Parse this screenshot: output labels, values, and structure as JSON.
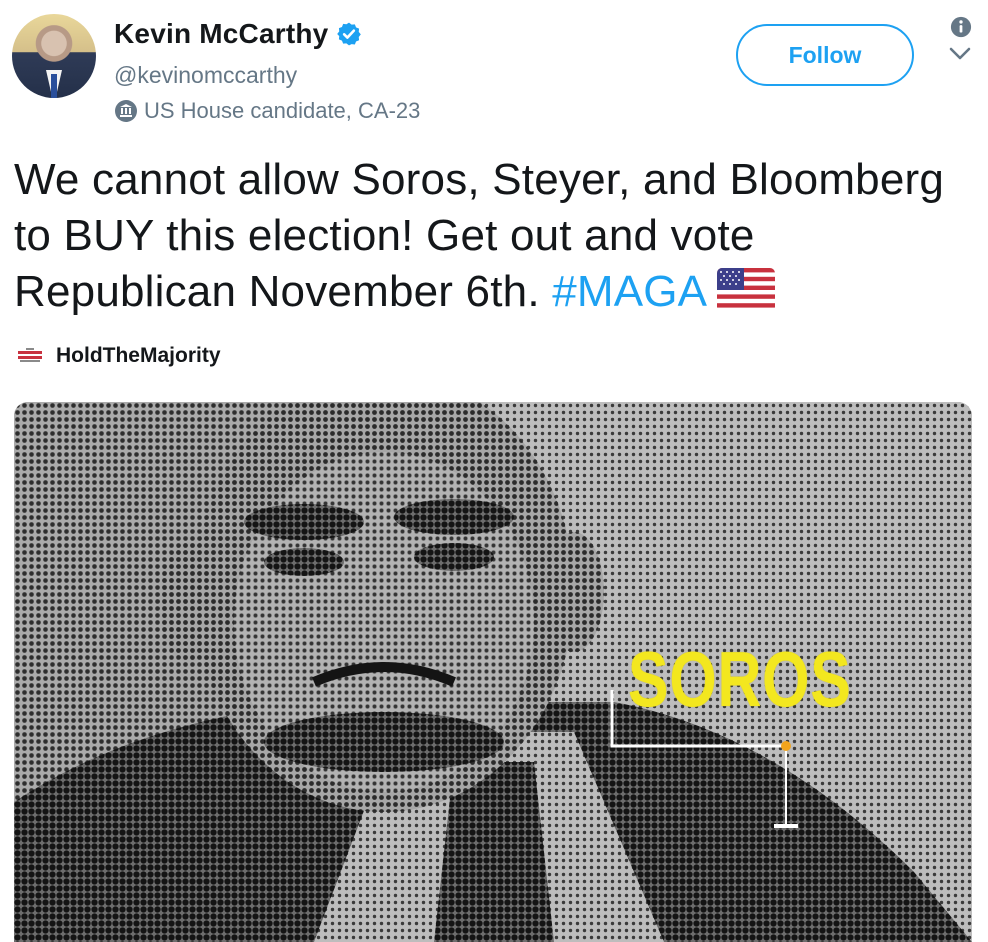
{
  "user": {
    "display_name": "Kevin McCarthy",
    "handle": "@kevinomccarthy",
    "label": "US House candidate, CA-23",
    "verified": true,
    "avatar": "profile-photo"
  },
  "actions": {
    "follow_label": "Follow",
    "info_icon": "info-icon",
    "more_icon": "chevron-down-icon"
  },
  "tweet": {
    "text_main": "We cannot allow Soros, Steyer, and Bloomberg to BUY this election! Get out and vote Republican November 6th. ",
    "hashtag": "#MAGA",
    "emoji": "us-flag"
  },
  "source": {
    "logo": "hold-the-majority-logo",
    "name": "HoldTheMajority"
  },
  "media": {
    "overlay_text": "SOROS"
  },
  "colors": {
    "accent": "#1da1f2",
    "secondary_text": "#657786",
    "overlay_yellow": "#f3e71f"
  }
}
